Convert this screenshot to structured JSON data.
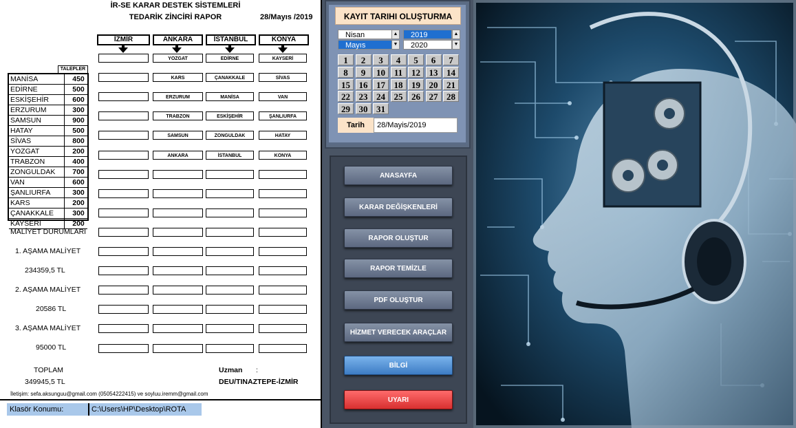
{
  "report": {
    "title_line1": "İR-SE KARAR DESTEK SİSTEMLERİ",
    "title_line2": "TEDARİK ZİNCİRİ RAPOR",
    "date": "28/Mayıs /2019",
    "columns": [
      "İZMİR",
      "ANKARA",
      "İSTANBUL",
      "KONYA"
    ],
    "talepler_header": "TALEPLER",
    "cities": [
      {
        "name": "MANİSA",
        "value": "450"
      },
      {
        "name": "EDİRNE",
        "value": "500"
      },
      {
        "name": "ESKİŞEHİR",
        "value": "600"
      },
      {
        "name": "ERZURUM",
        "value": "300"
      },
      {
        "name": "SAMSUN",
        "value": "900"
      },
      {
        "name": "HATAY",
        "value": "500"
      },
      {
        "name": "SİVAS",
        "value": "800"
      },
      {
        "name": "YOZGAT",
        "value": "200"
      },
      {
        "name": "TRABZON",
        "value": "400"
      },
      {
        "name": "ZONGULDAK",
        "value": "700"
      },
      {
        "name": "VAN",
        "value": "600"
      },
      {
        "name": "ŞANLIURFA",
        "value": "300"
      },
      {
        "name": "KARS",
        "value": "200"
      },
      {
        "name": "ÇANAKKALE",
        "value": "300"
      },
      {
        "name": "KAYSERİ",
        "value": "200"
      }
    ],
    "grid_rows": [
      [
        "",
        "YOZGAT",
        "EDİRNE",
        "KAYSERİ"
      ],
      [
        "",
        "KARS",
        "ÇANAKKALE",
        "SİVAS"
      ],
      [
        "",
        "ERZURUM",
        "MANİSA",
        "VAN"
      ],
      [
        "",
        "TRABZON",
        "ESKİŞEHİR",
        "ŞANLIURFA"
      ],
      [
        "",
        "SAMSUN",
        "ZONGULDAK",
        "HATAY"
      ],
      [
        "",
        "ANKARA",
        "İSTANBUL",
        "KONYA"
      ],
      [
        "",
        "",
        "",
        ""
      ],
      [
        "",
        "",
        "",
        ""
      ],
      [
        "",
        "",
        "",
        ""
      ],
      [
        "",
        "",
        "",
        ""
      ],
      [
        "",
        "",
        "",
        ""
      ],
      [
        "",
        "",
        "",
        ""
      ],
      [
        "",
        "",
        "",
        ""
      ],
      [
        "",
        "",
        "",
        ""
      ],
      [
        "",
        "",
        "",
        ""
      ],
      [
        "",
        "",
        "",
        ""
      ]
    ],
    "maliyet_title": "MALİYET DURUMLARI",
    "stage1_label": "1. AŞAMA MALİYET",
    "stage1_value": "234359,5  TL",
    "stage2_label": "2. AŞAMA MALİYET",
    "stage2_value": "20586  TL",
    "stage3_label": "3. AŞAMA MALİYET",
    "stage3_value": "95000  TL",
    "toplam_label": "TOPLAM",
    "toplam_value": "349945,5  TL",
    "uzman_label": "Uzman",
    "uzman_colon": ":",
    "uzman_value": "DEU/TINAZTEPE-İZMİR",
    "contact": "İletişim: sefa.aksunguu@gmail.com (05054222415) ve soyluu.iremm@gmail.com",
    "folder_label": "Klasör Konumu:",
    "folder_path": "C:\\Users\\HP\\Desktop\\ROTA"
  },
  "calendar": {
    "title": "KAYIT TARIHI OLUŞTURMA",
    "months": [
      "Nisan",
      "Mayıs"
    ],
    "selected_month": "Mayıs",
    "years": [
      "2019",
      "2020"
    ],
    "selected_year": "2019",
    "days": [
      "1",
      "2",
      "3",
      "4",
      "5",
      "6",
      "7",
      "8",
      "9",
      "10",
      "11",
      "12",
      "13",
      "14",
      "15",
      "16",
      "17",
      "18",
      "19",
      "20",
      "21",
      "22",
      "23",
      "24",
      "25",
      "26",
      "27",
      "28",
      "29",
      "30",
      "31"
    ],
    "tarih_label": "Tarih",
    "tarih_value": "28/Mayis/2019"
  },
  "nav": {
    "anasayfa": "ANASAYFA",
    "karar": "KARAR DEĞİŞKENLERİ",
    "rapor_olustur": "RAPOR OLUŞTUR",
    "rapor_temizle": "RAPOR TEMİZLE",
    "pdf": "PDF OLUŞTUR",
    "hizmet": "HİZMET VERECEK ARAÇLAR",
    "bilgi": "BİLGİ",
    "uyari": "UYARI"
  },
  "colors": {
    "accent_blue": "#3d7cc4",
    "alert_red": "#d83030",
    "calendar_bg": "#7f93b4",
    "label_bg": "#fbe3c8"
  }
}
